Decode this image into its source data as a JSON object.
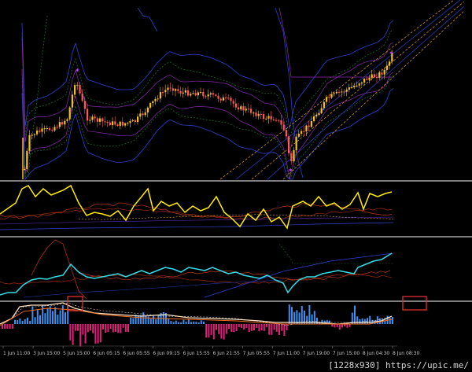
{
  "time_axis": {
    "labels": [
      "1 Jun 11:00",
      "3 Jun 15:00",
      "5 Jun 15:00",
      "6 Jun 05:15",
      "6 Jun 05:55",
      "6 Jun 09:15",
      "6 Jun 15:55",
      "6 Jun 21:55",
      "7 Jun 05:55",
      "7 Jun 11:00",
      "7 Jun 19:00",
      "7 Jun 15:00",
      "8 Jun 04:30",
      "8 Jun 08:30"
    ]
  },
  "colors": {
    "background": "#000000",
    "separator": "#c8c8c8",
    "bull_candle": "#f0c020",
    "bear_candle": "#ff5a5a",
    "main_oscillator": "#ffee00",
    "cyan_line": "#33dde6",
    "histogram_up": "#3d8ff0",
    "histogram_down": "#e0207a",
    "marker_box": "#e03030",
    "channel_dashed": "#e0a020",
    "band_blue": "#3040d0",
    "band_green": "#1c6b2a",
    "band_purple": "#8a2ab0"
  },
  "watermark": "[1228x930] https://upic.me/"
}
